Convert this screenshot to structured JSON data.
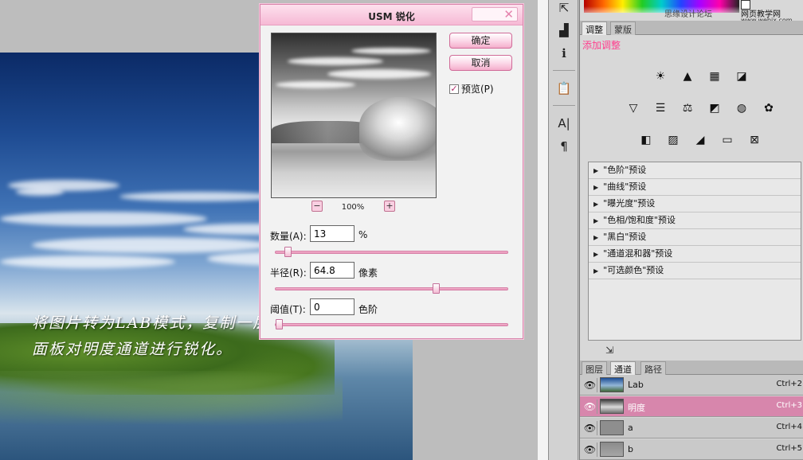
{
  "caption": {
    "line1": "将图片转为LAB模式，复制一层进入通道",
    "line2": "面板对明度通道进行锐化。"
  },
  "dialog": {
    "title": "USM 锐化",
    "close_glyph": "✕",
    "ok_label": "确定",
    "cancel_label": "取消",
    "preview_label": "预览(P)",
    "preview_checked": true,
    "zoom_out": "−",
    "zoom_in": "+",
    "zoom_level": "100%",
    "amount": {
      "label": "数量(A):",
      "value": "13",
      "unit": "%",
      "slider_fraction": 0.04
    },
    "radius": {
      "label": "半径(R):",
      "value": "64.8",
      "unit": "像素",
      "slider_fraction": 0.7
    },
    "threshold": {
      "label": "阈值(T):",
      "value": "0",
      "unit": "色阶",
      "slider_fraction": 0.0
    }
  },
  "watermark": {
    "site_a": "思缘设计论坛",
    "site_b": "网页教学网",
    "url": "www.webjx.com"
  },
  "toolbar": {
    "tools": [
      "move-tool-icon",
      "histogram-icon",
      "info-icon",
      "clipboard-icon",
      "character-icon",
      "paragraph-icon"
    ],
    "glyphs": [
      "⇱",
      "▟",
      "ℹ",
      "📋",
      "A|",
      "¶"
    ]
  },
  "adjust_panel": {
    "tabs": [
      "调整",
      "蒙版"
    ],
    "title": "添加调整",
    "icons": [
      {
        "name": "brightness-icon",
        "glyph": "☀"
      },
      {
        "name": "levels-icon",
        "glyph": "▲"
      },
      {
        "name": "curves-icon",
        "glyph": "▦"
      },
      {
        "name": "exposure-icon",
        "glyph": "◪"
      },
      {
        "name": "vibrance-icon",
        "glyph": "▽"
      },
      {
        "name": "hue-saturation-icon",
        "glyph": "☰"
      },
      {
        "name": "color-balance-icon",
        "glyph": "⚖"
      },
      {
        "name": "black-white-icon",
        "glyph": "◩"
      },
      {
        "name": "photo-filter-icon",
        "glyph": "◍"
      },
      {
        "name": "channel-mixer-icon",
        "glyph": "✿"
      },
      {
        "name": "invert-icon",
        "glyph": "◧"
      },
      {
        "name": "posterize-icon",
        "glyph": "▨"
      },
      {
        "name": "threshold-icon",
        "glyph": "◢"
      },
      {
        "name": "gradient-map-icon",
        "glyph": "▭"
      },
      {
        "name": "selective-color-icon",
        "glyph": "⊠"
      }
    ],
    "presets": [
      "\"色阶\"预设",
      "\"曲线\"预设",
      "\"曝光度\"预设",
      "\"色相/饱和度\"预设",
      "\"黑白\"预设",
      "\"通道混和器\"预设",
      "\"可选颜色\"预设"
    ]
  },
  "layers_panel": {
    "tabs": [
      "图层",
      "通道",
      "路径"
    ],
    "active_tab": 1,
    "channels": [
      {
        "name": "Lab",
        "shortcut": "Ctrl+2",
        "selected": false
      },
      {
        "name": "明度",
        "shortcut": "Ctrl+3",
        "selected": true
      },
      {
        "name": "a",
        "shortcut": "Ctrl+4",
        "selected": false
      },
      {
        "name": "b",
        "shortcut": "Ctrl+5",
        "selected": false
      }
    ]
  },
  "colors": {
    "dialog_accent": "#f6b9d5",
    "selected_channel": "#d786ac",
    "panel_title": "#ff3f8e"
  }
}
